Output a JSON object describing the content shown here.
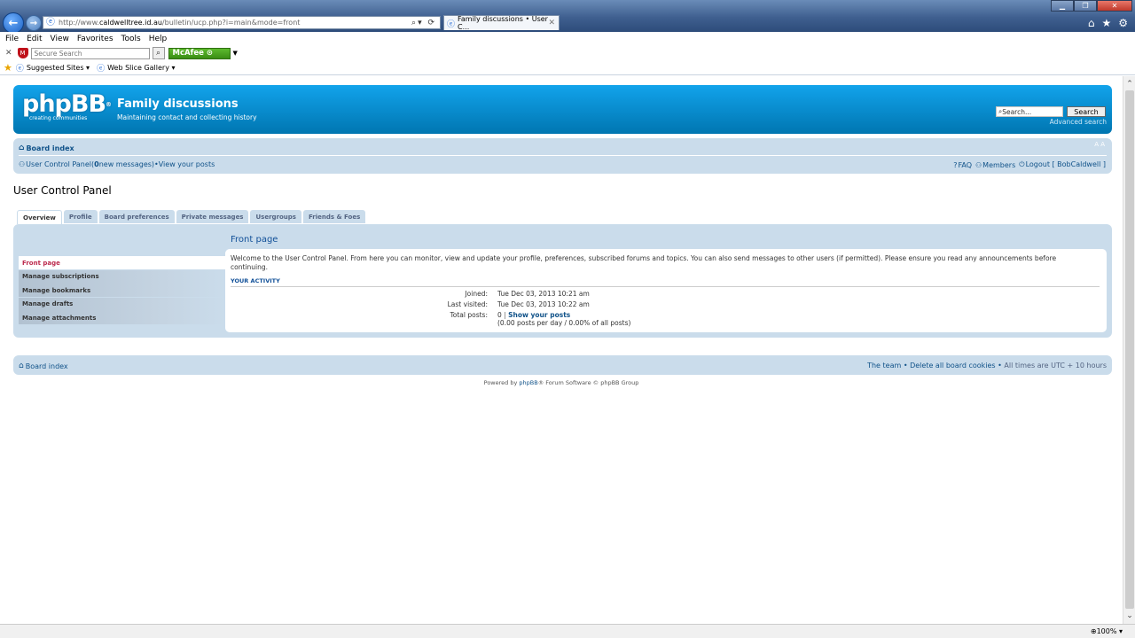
{
  "browser": {
    "url_prefix": "http://www.",
    "url_host": "caldwelltree.id.au",
    "url_path": "/bulletin/ucp.php?i=main&mode=front",
    "tab_title": "Family discussions • User C...",
    "menu": [
      "File",
      "Edit",
      "View",
      "Favorites",
      "Tools",
      "Help"
    ],
    "secure_search_placeholder": "Secure Search",
    "mcafee_label": "McAfee",
    "favorites": [
      "Suggested Sites ▾",
      "Web Slice Gallery ▾"
    ],
    "zoom": "100%"
  },
  "header": {
    "logo_text": "phpBB",
    "logo_tagline": "creating  communities",
    "site_title": "Family discussions",
    "site_desc": "Maintaining contact and collecting history",
    "search_placeholder": "Search...",
    "search_button": "Search",
    "advanced_search": "Advanced search"
  },
  "navbar": {
    "board_index": "Board index",
    "font_resize": "A A",
    "ucp_link": "User Control Panel",
    "new_messages_open": " (",
    "new_messages_count": "0",
    "new_messages_text": " new messages)",
    "bullet": " • ",
    "view_posts": "View your posts",
    "faq": "FAQ",
    "members": "Members",
    "logout": "Logout [ BobCaldwell ]"
  },
  "ucp": {
    "title": "User Control Panel",
    "tabs": [
      "Overview",
      "Profile",
      "Board preferences",
      "Private messages",
      "Usergroups",
      "Friends & Foes"
    ],
    "menu": [
      "Front page",
      "Manage subscriptions",
      "Manage bookmarks",
      "Manage drafts",
      "Manage attachments"
    ],
    "content_title": "Front page",
    "welcome": "Welcome to the User Control Panel. From here you can monitor, view and update your profile, preferences, subscribed forums and topics. You can also send messages to other users (if permitted). Please ensure you read any announcements before continuing.",
    "activity_heading": "YOUR ACTIVITY",
    "joined_label": "Joined:",
    "joined_value": "Tue Dec 03, 2013 10:21 am",
    "last_visited_label": "Last visited:",
    "last_visited_value": "Tue Dec 03, 2013 10:22 am",
    "total_posts_label": "Total posts:",
    "total_posts_value": "0",
    "total_posts_sep": " | ",
    "show_posts": "Show your posts",
    "posts_stats": "(0.00 posts per day / 0.00% of all posts)"
  },
  "footer": {
    "board_index": "Board index",
    "team": "The team",
    "delete_cookies": "Delete all board cookies",
    "timezone": "All times are UTC + 10 hours",
    "powered_prefix": "Powered by ",
    "powered_link": "phpBB",
    "powered_suffix": "® Forum Software © phpBB Group"
  }
}
